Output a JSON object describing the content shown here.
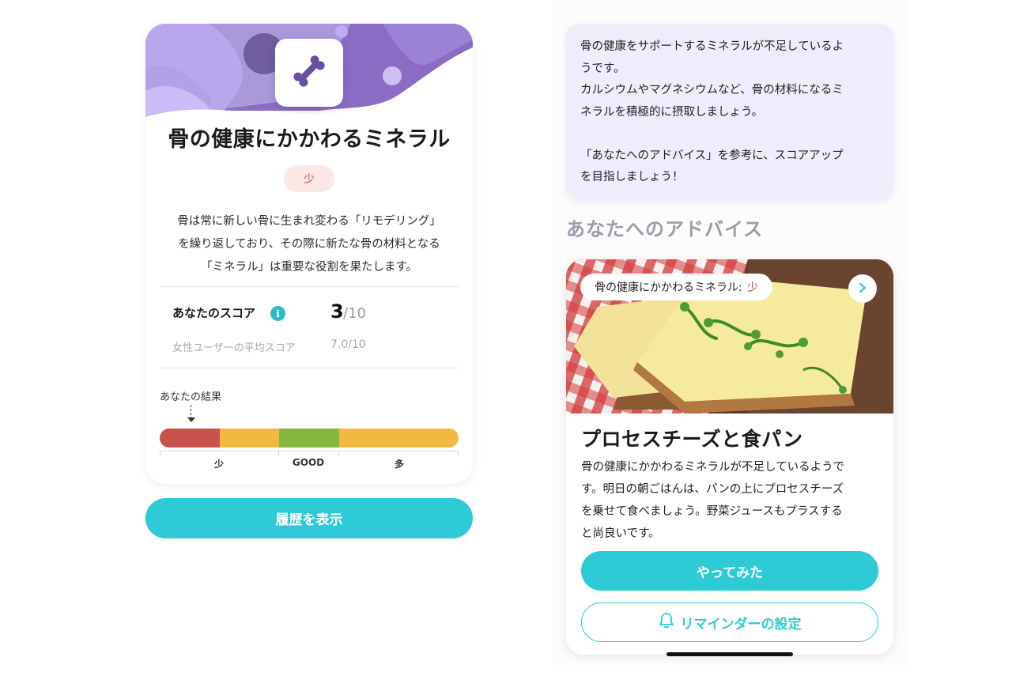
{
  "mineral_card": {
    "title": "骨の健康にかかわるミネラル",
    "level": "少",
    "description_lines": [
      "骨は常に新しい骨に生まれ変わる「リモデリング」",
      "を繰り返しており、その際に新たな骨の材料となる",
      "「ミネラル」は重要な役割を果たします。"
    ],
    "score_label": "あなたのスコア",
    "score": "3",
    "score_max": "/10",
    "average_label": "女性ユーザーの平均スコア",
    "average_value": "7.0/10",
    "result_label": "あなたの結果",
    "scale_labels": [
      "少",
      "GOOD",
      "多"
    ],
    "scale_colors": [
      "#c9534c",
      "#f1b942",
      "#86b840",
      "#f1b942",
      "#f1b942"
    ],
    "icon": "bone-icon"
  },
  "history_button": "履歴を表示",
  "message": {
    "lines": [
      "骨の健康をサポートするミネラルが不足しているよ",
      "うです。",
      "カルシウムやマグネシウムなど、骨の材料になるミ",
      "ネラルを積極的に摂取しましょう。",
      "",
      "「あなたへのアドバイス」を参考に、スコアアップ",
      "を目指しましょう！"
    ]
  },
  "advice": {
    "heading": "あなたへのアドバイス",
    "chip_text": "骨の健康にかかわるミネラル:",
    "chip_level": "少",
    "photo": "cheese-toast-photo",
    "title": "プロセスチーズと食パン",
    "body_lines": [
      "骨の健康にかかわるミネラルが不足しているようで",
      "す。明日の朝ごはんは、パンの上にプロセスチーズ",
      "を乗せて食べましょう。野菜ジュースもプラスする",
      "と尚良いです。"
    ],
    "try_button": "やってみた",
    "reminder_button": "リマインダーの設定",
    "accent": "#2ecad5"
  }
}
